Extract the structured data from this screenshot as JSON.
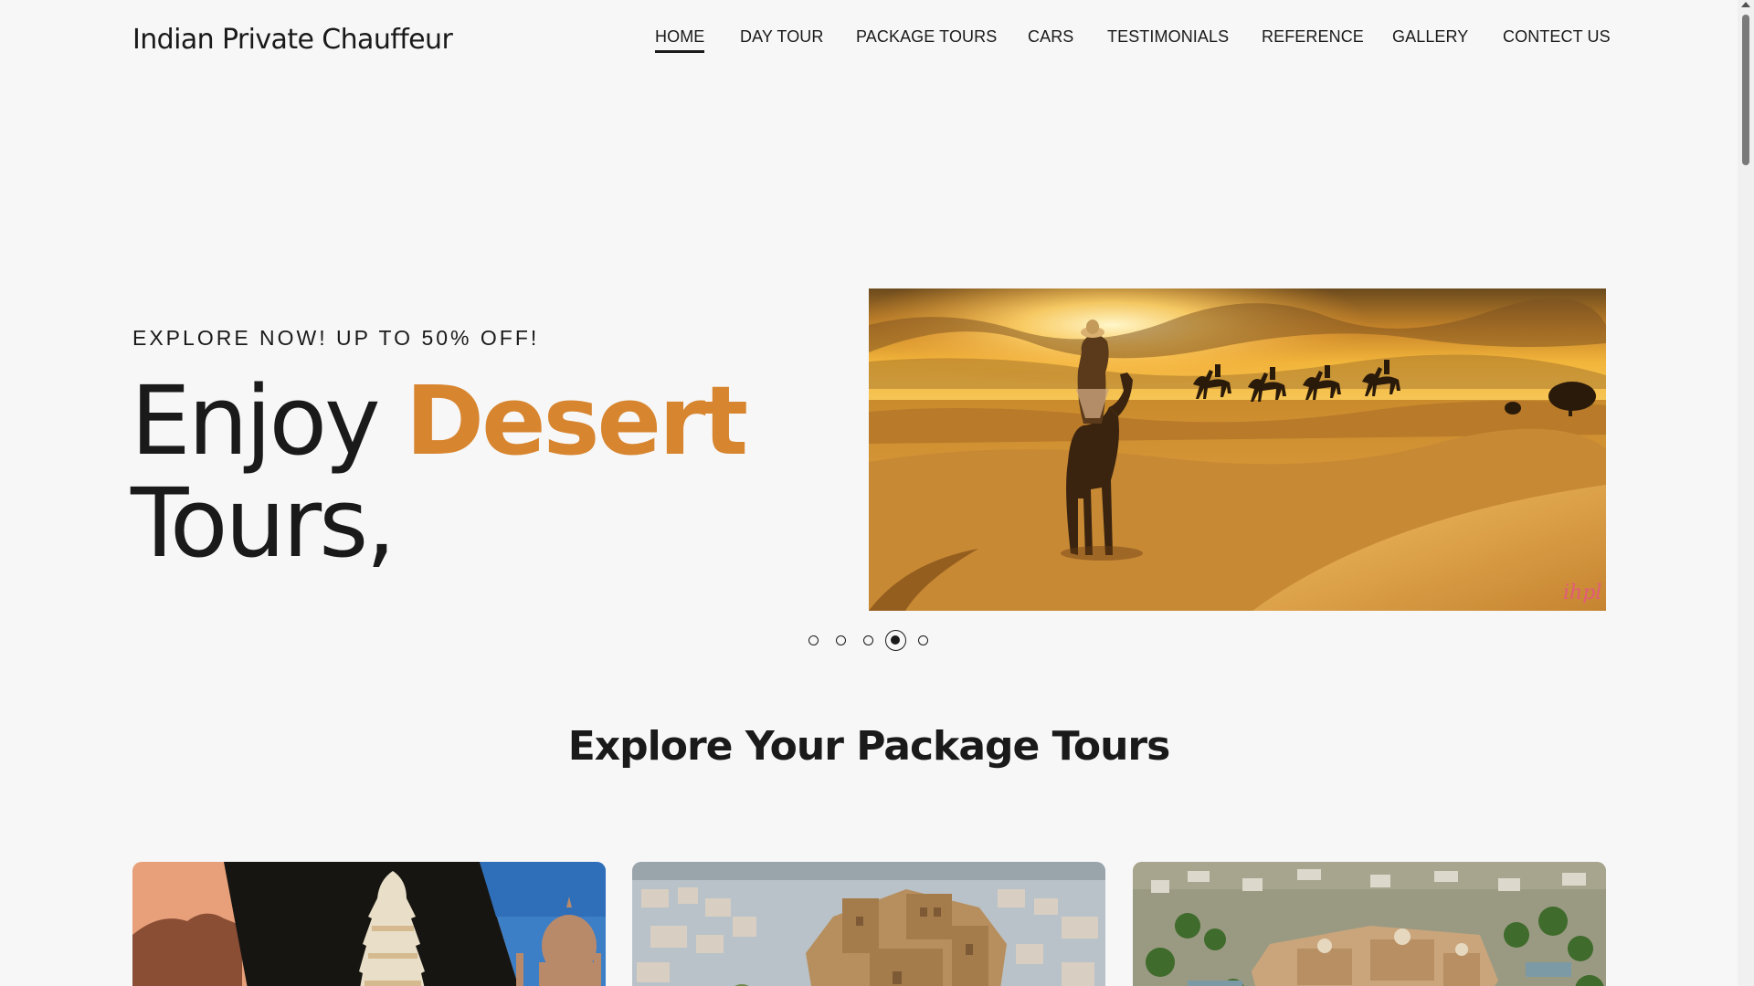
{
  "brand": {
    "name": "Indian Private Chauffeur"
  },
  "nav": {
    "items": [
      {
        "label": "HOME",
        "active": true
      },
      {
        "label": "DAY TOUR"
      },
      {
        "label": "PACKAGE TOURS"
      },
      {
        "label": "CARS"
      },
      {
        "label": "TESTIMONIALS"
      },
      {
        "label": "REFERENCE"
      },
      {
        "label": "GALLERY"
      },
      {
        "label": "CONTECT US"
      }
    ]
  },
  "hero": {
    "eyebrow": "EXPLORE NOW! UP TO 50% OFF!",
    "title_prefix": "Enjoy",
    "title_accent": "Desert",
    "title_suffix": "Tours,",
    "image_watermark": "ihpl",
    "accent_color": "#d8852f"
  },
  "carousel": {
    "slide_count": 5,
    "active_index": 4
  },
  "packages": {
    "title": "Explore Your Package Tours"
  }
}
